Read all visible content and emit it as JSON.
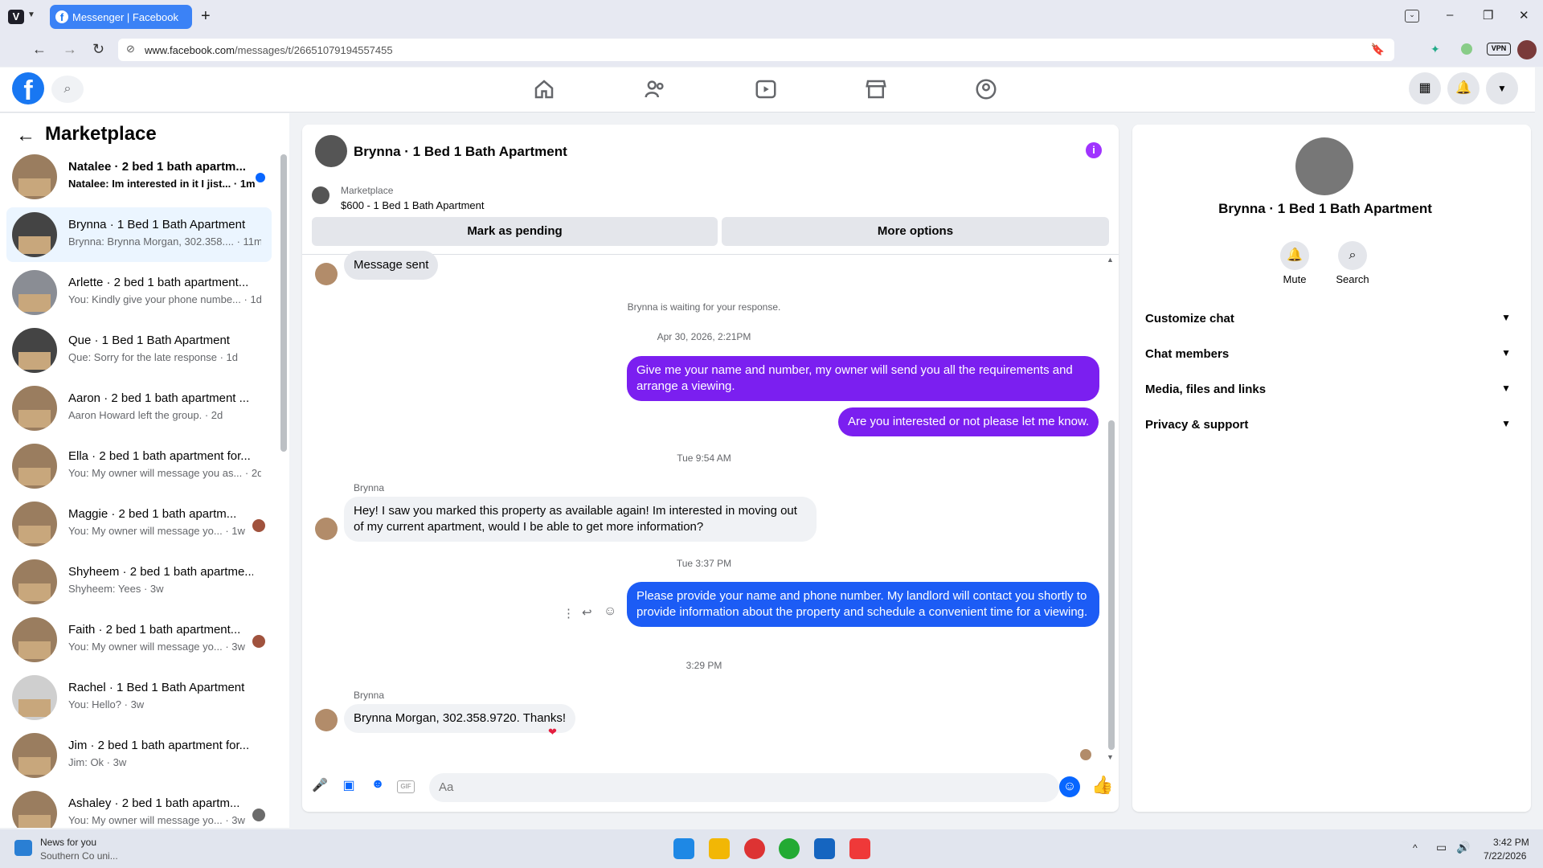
{
  "browser": {
    "tab_title": "Messenger | Facebook",
    "url_domain": "www.facebook.com",
    "url_path": "/messages/t/26651079194557455",
    "vpn_label": "VPN"
  },
  "sidebar": {
    "title": "Marketplace",
    "conversations": [
      {
        "name": "Natalee · 2 bed 1 bath apartm...",
        "preview": "Natalee: Im interested in it I jist... · 1m",
        "unread": true
      },
      {
        "name": "Brynna · 1 Bed 1 Bath Apartment",
        "preview": "Brynna: Brynna Morgan, 302.358.... · 11m",
        "active": true
      },
      {
        "name": "Arlette · 2 bed 1 bath apartment...",
        "preview": "You: Kindly give your phone numbe... · 1d"
      },
      {
        "name": "Que · 1 Bed 1 Bath Apartment",
        "preview": "Que: Sorry for the late response · 1d"
      },
      {
        "name": "Aaron · 2 bed 1 bath apartment ...",
        "preview": "Aaron Howard left the group. · 2d"
      },
      {
        "name": "Ella · 2 bed 1 bath apartment for...",
        "preview": "You: My owner will message you as... · 2d"
      },
      {
        "name": "Maggie · 2 bed 1 bath apartm...",
        "preview": "You: My owner will message yo... · 1w"
      },
      {
        "name": "Shyheem · 2 bed 1 bath apartme...",
        "preview": "Shyheem: Yees · 3w"
      },
      {
        "name": "Faith · 2 bed 1 bath apartment...",
        "preview": "You: My owner will message yo... · 3w"
      },
      {
        "name": "Rachel · 1 Bed 1 Bath Apartment",
        "preview": "You: Hello? · 3w"
      },
      {
        "name": "Jim · 2 bed 1 bath apartment for...",
        "preview": "Jim: Ok · 3w"
      },
      {
        "name": "Ashaley · 2 bed 1 bath apartm...",
        "preview": "You: My owner will message yo... · 3w"
      }
    ]
  },
  "chat": {
    "title": "Brynna · 1 Bed 1 Bath Apartment",
    "listing_label": "Marketplace",
    "listing_price": "$600 - 1 Bed 1 Bath Apartment",
    "mark_pending": "Mark as pending",
    "more_options": "More options",
    "message_sent": "Message sent",
    "waiting_notice": "Brynna is waiting for your response.",
    "ts1": "Apr 30, 2026, 2:21PM",
    "out1": "Give me your name and number, my owner will send you all the requirements and arrange a viewing.",
    "out2": "Are you interested or not please let me know.",
    "ts2": "Tue 9:54 AM",
    "sender1": "Brynna",
    "in1": "Hey! I saw you marked this property as available again! Im interested in moving out of my current apartment, would I be able to get more information?",
    "ts3": "Tue 3:37 PM",
    "out3": "Please provide your name and phone number. My landlord will contact you shortly to provide information about the property and schedule a convenient time for a viewing.",
    "ts4": "3:29 PM",
    "sender2": "Brynna",
    "in2": "Brynna Morgan, 302.358.9720. Thanks!",
    "input_placeholder": "Aa",
    "gif_label": "GIF"
  },
  "details": {
    "name": "Brynna · 1 Bed 1 Bath Apartment",
    "mute": "Mute",
    "search": "Search",
    "sections": [
      "Customize chat",
      "Chat members",
      "Media, files and links",
      "Privacy & support"
    ]
  },
  "taskbar": {
    "news_title": "News for you",
    "news_sub": "Southern Co uni...",
    "time": "3:42 PM",
    "date": "7/22/2026"
  },
  "colors": {
    "accent": "#0866ff",
    "outgoing_purple": "#7b1ff0",
    "outgoing_blue": "#1c5cf5",
    "info": "#a033ff"
  }
}
